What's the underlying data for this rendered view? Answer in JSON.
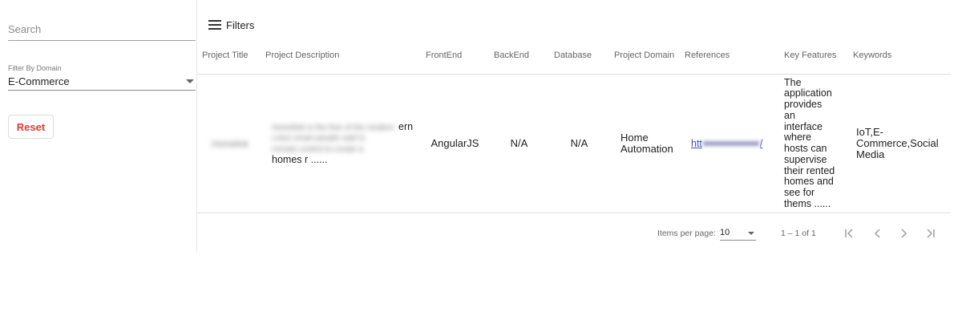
{
  "sidebar": {
    "search_placeholder": "Search",
    "filter_label": "Filter By Domain",
    "domain_value": "E-Commerce",
    "reset_label": "Reset"
  },
  "toolbar": {
    "filters_label": "Filters"
  },
  "table": {
    "headers": [
      "Project Title",
      "Project Description",
      "FrontEnd",
      "BackEnd",
      "Database",
      "Project Domain",
      "References",
      "Key Features",
      "Keywords"
    ],
    "rows": [
      {
        "title": "Homelink",
        "description_blurred": "Homelink is the free of the modern Lotus smart people said is",
        "description_end": "ern",
        "description_line2_blurred": "remote control to create a",
        "description_tail": "homes r ......",
        "frontend": "AngularJS",
        "backend": "N/A",
        "database": "N/A",
        "domain": "Home Automation",
        "reference_prefix": "htt",
        "reference_suffix": "/",
        "key_features": "The application provides an interface where hosts can supervise their rented homes and see for thems ......",
        "keywords": "IoT,E-Commerce,Social Media"
      }
    ]
  },
  "paginator": {
    "items_per_page_label": "Items per page:",
    "items_per_page_value": "10",
    "range_label": "1 – 1 of 1"
  }
}
